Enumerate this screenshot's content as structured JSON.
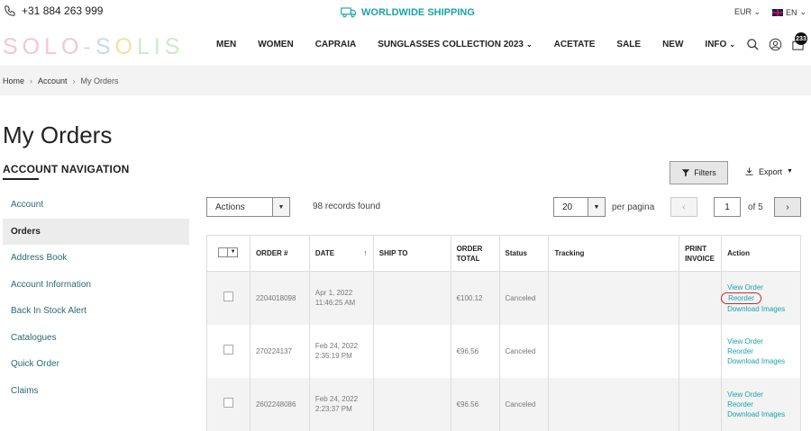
{
  "top": {
    "phone": "+31 884 263 999",
    "shipping": "WORLDWIDE SHIPPING",
    "currency": "EUR",
    "language": "EN"
  },
  "header": {
    "logo": "SOLO-SOLIS",
    "nav": [
      {
        "label": "MEN",
        "dropdown": false
      },
      {
        "label": "WOMEN",
        "dropdown": false
      },
      {
        "label": "CAPRAIA",
        "dropdown": false
      },
      {
        "label": "SUNGLASSES COLLECTION 2023",
        "dropdown": true
      },
      {
        "label": "ACETATE",
        "dropdown": false
      },
      {
        "label": "SALE",
        "dropdown": false
      },
      {
        "label": "NEW",
        "dropdown": false
      },
      {
        "label": "INFO",
        "dropdown": true
      }
    ],
    "cart_count": "233"
  },
  "breadcrumb": [
    "Home",
    "Account",
    "My Orders"
  ],
  "page_title": "My Orders",
  "account_nav": {
    "title": "ACCOUNT NAVIGATION",
    "items": [
      "Account",
      "Orders",
      "Address Book",
      "Account Information",
      "Back In Stock Alert",
      "Catalogues",
      "Quick Order",
      "Claims"
    ],
    "active": "Orders"
  },
  "toolbar": {
    "filters": "Filters",
    "export": "Export",
    "actions": "Actions",
    "records": "98 records found",
    "per_page_value": "20",
    "per_page_label": "per pagina",
    "page": "1",
    "of_pages": "of 5"
  },
  "table": {
    "headers": [
      "",
      "ORDER #",
      "DATE",
      "SHIP TO",
      "ORDER TOTAL",
      "Status",
      "Tracking",
      "PRINT INVOICE",
      "Action"
    ],
    "rows": [
      {
        "order": "2204018098",
        "date1": "Apr 1, 2022",
        "date2": "11:46:25 AM",
        "ship_to": "",
        "total": "€100.12",
        "status": "Canceled",
        "tracking": "",
        "invoice": ""
      },
      {
        "order": "270224137",
        "date1": "Feb 24, 2022",
        "date2": "2:35:19 PM",
        "ship_to": "",
        "total": "€96.56",
        "status": "Canceled",
        "tracking": "",
        "invoice": ""
      },
      {
        "order": "2602248086",
        "date1": "Feb 24, 2022",
        "date2": "2:23:37 PM",
        "ship_to": "",
        "total": "€96.56",
        "status": "Canceled",
        "tracking": "",
        "invoice": ""
      }
    ],
    "actions": [
      "View Order",
      "Reorder",
      "Download Images"
    ]
  },
  "colors": {
    "accent": "#1aa3a8",
    "highlight": "#d9232b"
  }
}
